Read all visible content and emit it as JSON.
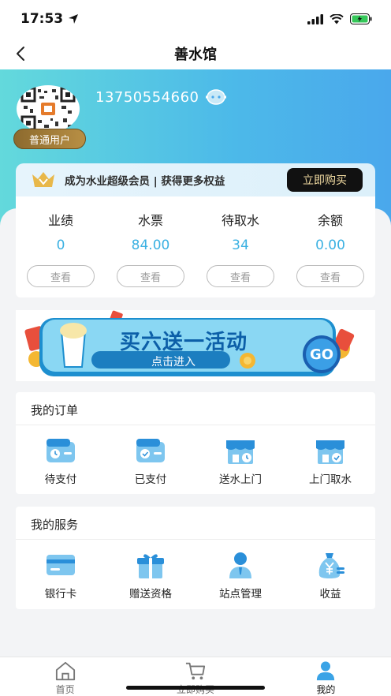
{
  "status": {
    "time": "17:53"
  },
  "nav": {
    "title": "善水馆"
  },
  "user": {
    "phone": "13750554660",
    "level": "普通用户"
  },
  "member": {
    "text": "成为水业超级会员 | 获得更多权益",
    "button": "立即购买"
  },
  "stats": [
    {
      "label": "业绩",
      "value": "0",
      "button": "查看"
    },
    {
      "label": "水票",
      "value": "84.00",
      "button": "查看"
    },
    {
      "label": "待取水",
      "value": "34",
      "button": "查看"
    },
    {
      "label": "余额",
      "value": "0.00",
      "button": "查看"
    }
  ],
  "promo": {
    "title": "买六送一活动",
    "button": "点击进入",
    "go": "GO"
  },
  "orders": {
    "title": "我的订单",
    "items": [
      {
        "label": "待支付",
        "icon": "wallet-clock-icon"
      },
      {
        "label": "已支付",
        "icon": "wallet-check-icon"
      },
      {
        "label": "送水上门",
        "icon": "store-clock-icon"
      },
      {
        "label": "上门取水",
        "icon": "store-check-icon"
      }
    ]
  },
  "services": {
    "title": "我的服务",
    "items": [
      {
        "label": "银行卡",
        "icon": "bank-card-icon"
      },
      {
        "label": "赠送资格",
        "icon": "gift-icon"
      },
      {
        "label": "站点管理",
        "icon": "manager-icon"
      },
      {
        "label": "收益",
        "icon": "money-bag-icon"
      }
    ]
  },
  "tabs": [
    {
      "label": "首页",
      "icon": "home-icon"
    },
    {
      "label": "立即购买",
      "icon": "cart-icon"
    },
    {
      "label": "我的",
      "icon": "user-icon",
      "active": true
    }
  ],
  "colors": {
    "accent": "#3bb1e2",
    "header_start": "#63d9dc",
    "header_end": "#4aa8ec",
    "gold": "#b88f44"
  }
}
